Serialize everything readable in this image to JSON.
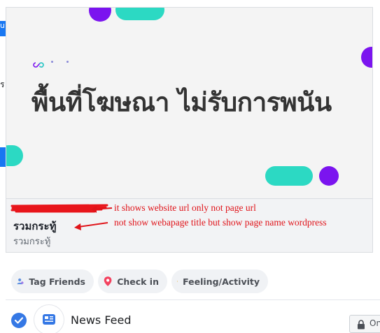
{
  "sidebar_fragments": {
    "top_label": "u",
    "mid_char": "ร"
  },
  "link_preview": {
    "banner": {
      "headline": "พื้นที่โฆษณา ไม่รับการพนัน",
      "colors": {
        "purple": "#7b14ef",
        "teal": "#2cd9c3",
        "text": "#333333"
      }
    },
    "url": "",
    "title": "รวมกระทู้",
    "description": "รวมกระทู้"
  },
  "annotations": {
    "url_note": "it shows website url only not page url",
    "title_note": "not show webapage title but show page name wordpress",
    "color": "#e0141a"
  },
  "composer_actions": [
    {
      "label": "Tag Friends",
      "icon": "tag-friends-icon"
    },
    {
      "label": "Check in",
      "icon": "location-pin-icon"
    },
    {
      "label": "Feeling/Activity",
      "icon": "smiley-icon"
    }
  ],
  "share_targets": {
    "news_feed_label": "News Feed",
    "news_feed_checked": true,
    "privacy_label": "On"
  }
}
